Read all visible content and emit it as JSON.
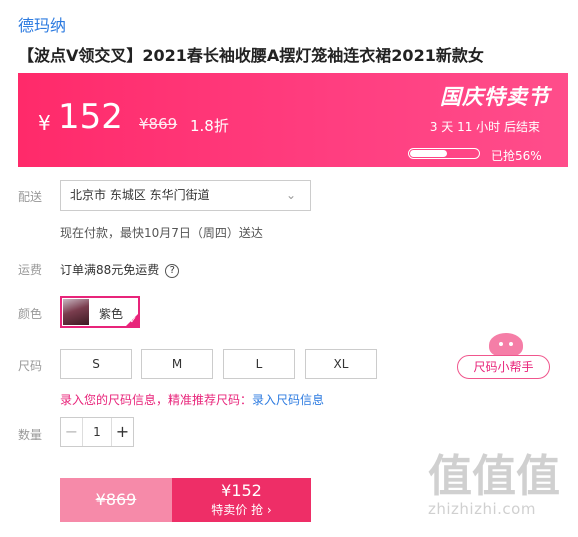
{
  "brand": "德玛纳",
  "product_title": "【波点V领交叉】2021春长袖收腰A摆灯笼袖连衣裙2021新款女",
  "banner": {
    "yen": "¥",
    "price": "152",
    "original_price": "¥869",
    "discount": "1.8折",
    "event": "国庆特卖节",
    "countdown": "3  天  11  小时  后结束",
    "sold_text": "已抢56%",
    "sold_fraction": 0.56,
    "color": "#ff2a6a"
  },
  "delivery": {
    "label": "配送",
    "address": "北京市  东城区  东华门街道",
    "estimate": "现在付款，最快10月7日（周四）送达"
  },
  "shipping": {
    "label": "运费",
    "text": "订单满88元免运费",
    "help_icon": "?"
  },
  "color": {
    "label": "颜色",
    "selected": "紫色"
  },
  "size": {
    "label": "尺码",
    "options": [
      "S",
      "M",
      "L",
      "XL"
    ],
    "helper": "尺码小帮手",
    "tip_text": "录入您的尺码信息，精准推荐尺码：",
    "tip_link": "录入尺码信息"
  },
  "quantity": {
    "label": "数量",
    "value": "1",
    "minus": "−",
    "plus": "+"
  },
  "buy": {
    "original": "¥869",
    "price": "¥152",
    "action": "特卖价 抢 ›"
  },
  "watermark": {
    "glyphs": "值值值",
    "url": "zhizhizhi.com"
  }
}
